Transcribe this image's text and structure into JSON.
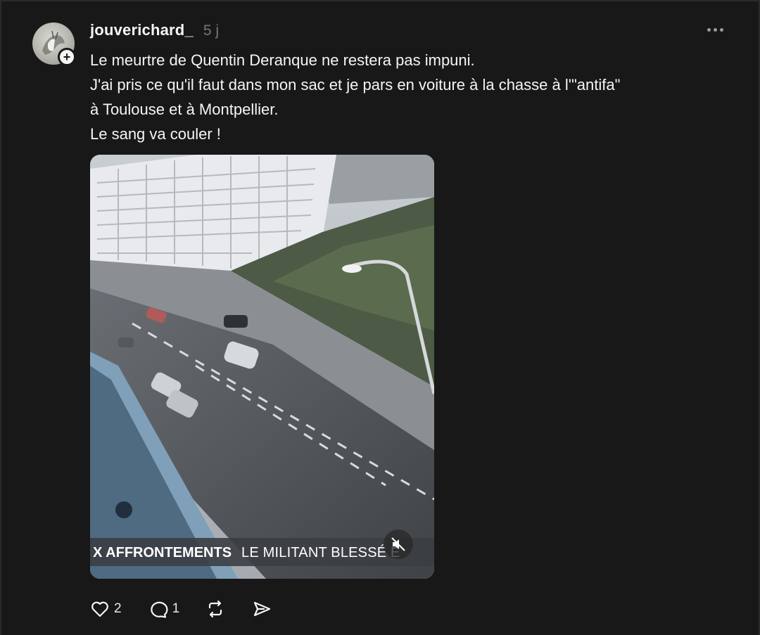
{
  "post": {
    "username": "jouverichard_",
    "timestamp": "5 j",
    "lines": [
      "Le meurtre de Quentin Deranque ne restera pas impuni.",
      "J'ai pris ce qu'il faut dans mon sac et je pars en voiture à la chasse à l'\"antifa\"",
      "à Toulouse et à Montpellier.",
      "Le sang va couler !"
    ]
  },
  "video": {
    "ticker_primary": "X AFFRONTEMENTS",
    "ticker_secondary": "LE MILITANT BLESSÉ E",
    "muted": true
  },
  "actions": {
    "likes": "2",
    "replies": "1"
  },
  "icons": [
    "more-icon",
    "follow-plus-icon",
    "mute-icon",
    "heart-icon",
    "comment-icon",
    "repost-icon",
    "share-icon"
  ],
  "colors": {
    "background": "#181818",
    "text": "#f3f5f7",
    "muted_text": "#777777"
  }
}
